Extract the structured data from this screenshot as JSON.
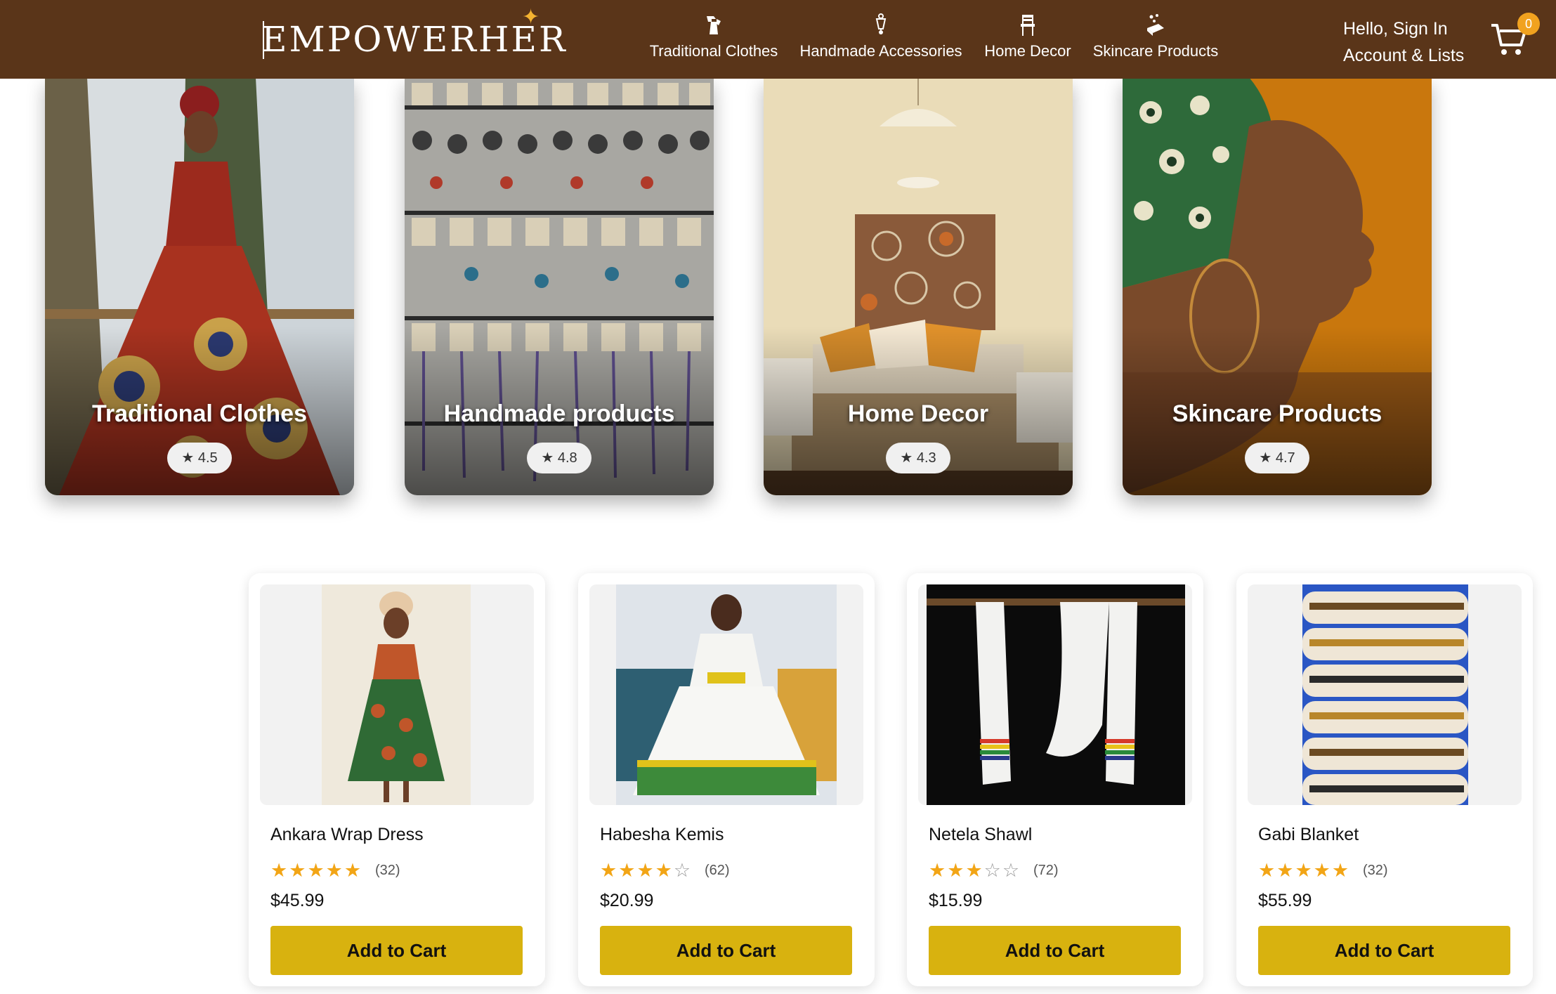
{
  "header": {
    "logo_text": "EMPOWERHER",
    "nav": [
      {
        "label": "Traditional Clothes",
        "icon": "dress-icon"
      },
      {
        "label": "Handmade Accessories",
        "icon": "earring-icon"
      },
      {
        "label": "Home Decor",
        "icon": "chair-icon"
      },
      {
        "label": "Skincare Products",
        "icon": "soap-icon"
      }
    ],
    "account_greeting": "Hello, Sign In",
    "account_lists": "Account & Lists",
    "cart_icon": "cart-icon",
    "cart_count": "0"
  },
  "categories": [
    {
      "title": "Traditional Clothes",
      "rating": "★ 4.5"
    },
    {
      "title": "Handmade products",
      "rating": "★ 4.8"
    },
    {
      "title": "Home Decor",
      "rating": "★ 4.3"
    },
    {
      "title": "Skincare Products",
      "rating": "★ 4.7"
    }
  ],
  "products": [
    {
      "name": "Ankara Wrap Dress",
      "stars": 5,
      "reviews": "(32)",
      "price": "$45.99",
      "button": "Add to Cart"
    },
    {
      "name": "Habesha Kemis",
      "stars": 4,
      "reviews": "(62)",
      "price": "$20.99",
      "button": "Add to Cart"
    },
    {
      "name": "Netela Shawl",
      "stars": 3,
      "reviews": "(72)",
      "price": "$15.99",
      "button": "Add to Cart"
    },
    {
      "name": "Gabi Blanket",
      "stars": 5,
      "reviews": "(32)",
      "price": "$55.99",
      "button": "Add to Cart"
    }
  ],
  "colors": {
    "header_bg": "#5a3519",
    "logo_spark": "#f4b331",
    "cart_badge": "#f1a21f",
    "star": "#f2a516",
    "button": "#d8b20f"
  }
}
